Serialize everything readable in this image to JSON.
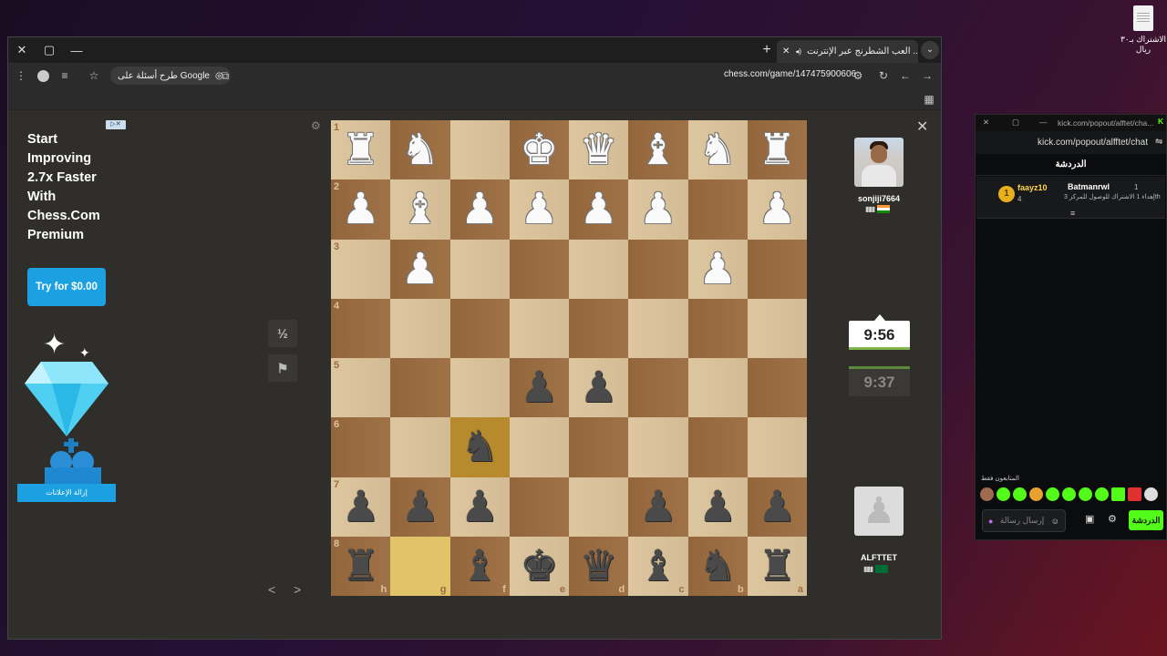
{
  "desktop": {
    "icon_label_line1": "الاشتراك بـ٣٠",
    "icon_label_line2": "ريال"
  },
  "browser": {
    "tab_title": "العب الشطرنج عبر الإنترنت ...",
    "url": "chess.com/game/147475900606",
    "search_pill": "طرح أسئلة على Google",
    "close_glyph": "✕",
    "maximize_glyph": "▢",
    "minimize_glyph": "—"
  },
  "ad": {
    "headline": "Start Improving 2.7x Faster With Chess.Com Premium",
    "cta": "Try for $0.00",
    "remove_ads": "إزالة الإعلانات"
  },
  "controls": {
    "draw_label": "½",
    "resign_icon": "flag-icon",
    "nav_label": "< >"
  },
  "board": {
    "orientation": "black-bottom",
    "ranks": [
      "1",
      "2",
      "3",
      "4",
      "5",
      "6",
      "7",
      "8"
    ],
    "files": [
      "h",
      "g",
      "f",
      "e",
      "d",
      "c",
      "b",
      "a"
    ],
    "rows": [
      [
        "wR",
        "wN",
        "",
        "wK",
        "wQ",
        "wB",
        "wN",
        "wR"
      ],
      [
        "wP",
        "wB",
        "wP",
        "wP",
        "wP",
        "wP",
        "",
        "wP"
      ],
      [
        "",
        "wP",
        "",
        "",
        "",
        "",
        "wP",
        ""
      ],
      [
        "",
        "",
        "",
        "",
        "",
        "",
        "",
        ""
      ],
      [
        "",
        "",
        "",
        "bP",
        "bP",
        "",
        "",
        ""
      ],
      [
        "",
        "",
        "bN",
        "",
        "",
        "",
        "",
        ""
      ],
      [
        "bP",
        "bP",
        "bP",
        "",
        "",
        "bP",
        "bP",
        "bP"
      ],
      [
        "bR",
        "",
        "bB",
        "bK",
        "bQ",
        "bB",
        "bN",
        "bR"
      ]
    ],
    "highlight": [
      [
        5,
        2
      ],
      [
        7,
        1
      ]
    ]
  },
  "players": {
    "top": {
      "name": "sonjiji7664",
      "country": "India"
    },
    "bottom": {
      "name": "ALFTTET",
      "country": "Saudi Arabia"
    },
    "clock_active": "9:56",
    "clock_idle": "9:37"
  },
  "kick": {
    "title": "kick.com/popout/alftet/cha...",
    "url": "kick.com/popout/alfftet/chat",
    "tab": "الدردشة",
    "rank": "1",
    "user1": "faayz10",
    "user1_count": "4",
    "user2": "Batmanrwl",
    "user2_count": "1",
    "message": "إهداء 1 الاشتراك للوصول للمركز 3th",
    "subs_only": "المتابعون فقط",
    "input_placeholder": "إرسال رسالة",
    "chat_button": "الدردشة"
  },
  "colors": {
    "light_square": "#dbc39b",
    "dark_square": "#9c6c3f",
    "highlight": "#e1c46a",
    "accent": "#1ba1e2",
    "kick_green": "#53fc18"
  }
}
